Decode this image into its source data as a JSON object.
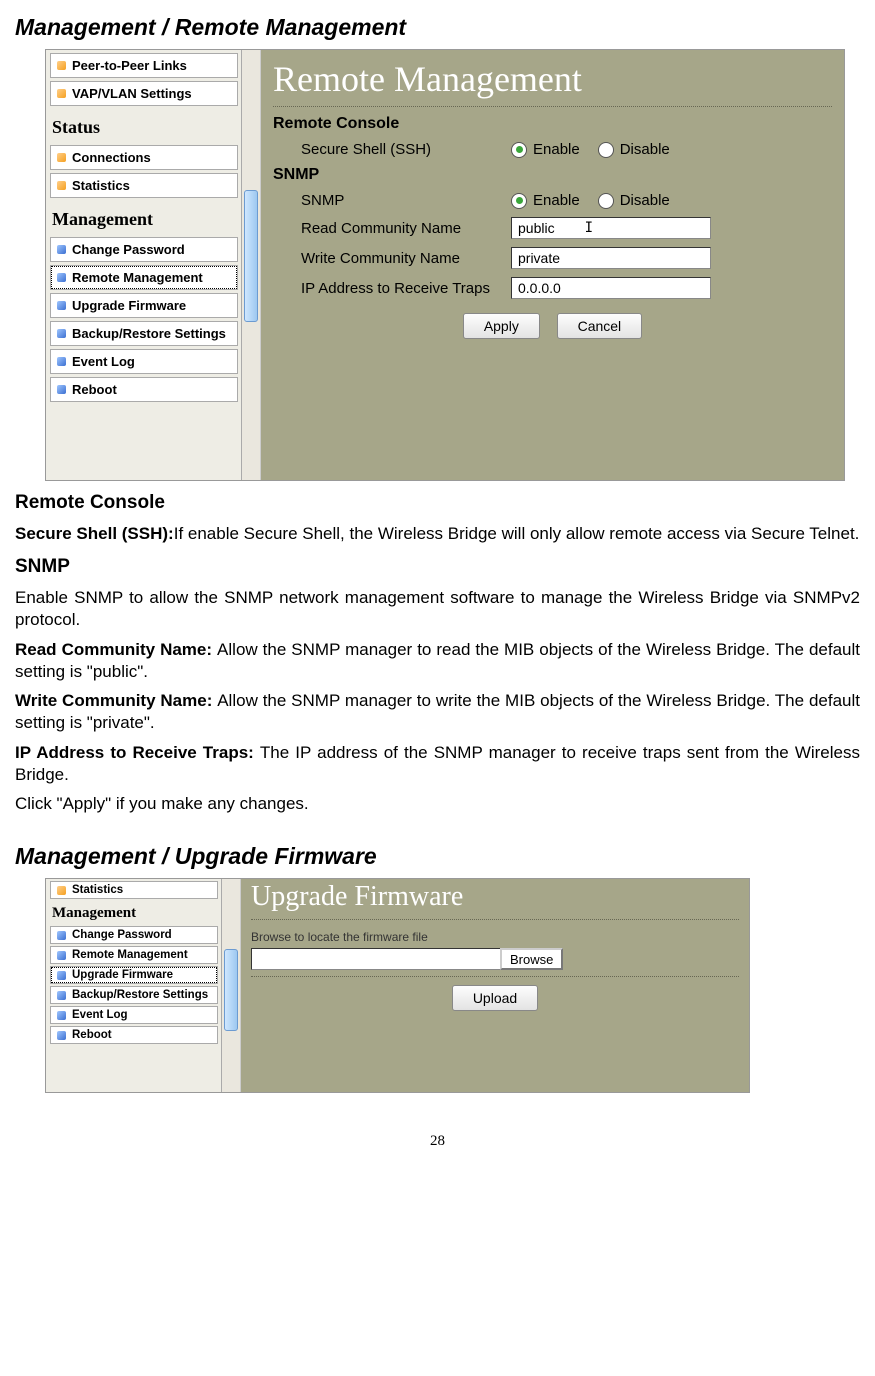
{
  "heading1": "Management / Remote Management",
  "screenshot1": {
    "sidebar": {
      "items_top": [
        {
          "label": "Peer-to-Peer Links",
          "bullet": "orange"
        },
        {
          "label": "VAP/VLAN Settings",
          "bullet": "orange"
        }
      ],
      "status_heading": "Status",
      "status_items": [
        {
          "label": "Connections",
          "bullet": "orange"
        },
        {
          "label": "Statistics",
          "bullet": "orange"
        }
      ],
      "mgmt_heading": "Management",
      "mgmt_items": [
        {
          "label": "Change Password",
          "bullet": "blue"
        },
        {
          "label": "Remote Management",
          "bullet": "blue",
          "selected": true
        },
        {
          "label": "Upgrade Firmware",
          "bullet": "blue"
        },
        {
          "label": "Backup/Restore Settings",
          "bullet": "blue"
        },
        {
          "label": "Event Log",
          "bullet": "blue"
        },
        {
          "label": "Reboot",
          "bullet": "blue"
        }
      ]
    },
    "main": {
      "title": "Remote Management",
      "remote_console_heading": "Remote Console",
      "ssh_label": "Secure Shell (SSH)",
      "enable": "Enable",
      "disable": "Disable",
      "snmp_heading": "SNMP",
      "snmp_label": "SNMP",
      "read_label": "Read Community Name",
      "read_value": "public",
      "write_label": "Write Community Name",
      "write_value": "private",
      "ip_label": "IP Address to Receive Traps",
      "ip_value": "0.0.0.0",
      "apply": "Apply",
      "cancel": "Cancel"
    }
  },
  "doc": {
    "remote_console": "Remote Console",
    "ssh_label": "Secure Shell (SSH):",
    "ssh_text": "If enable Secure Shell, the Wireless Bridge will only allow remote access via Secure Telnet.",
    "snmp_h": "SNMP",
    "snmp_text": "Enable SNMP to allow the SNMP network management software to manage the Wireless Bridge via SNMPv2 protocol.",
    "read_label": "Read Community Name: ",
    "read_text": "Allow the SNMP manager to read the MIB objects of the Wireless Bridge. The default setting is \"public\".",
    "write_label": "Write Community Name: ",
    "write_text": "Allow the SNMP manager to write the MIB objects of the Wireless Bridge. The default setting is \"private\".",
    "ip_label": "IP Address to Receive Traps: ",
    "ip_text": "The IP address of the SNMP manager to receive traps sent from the Wireless Bridge.",
    "apply_text": "Click \"Apply\" if you make any changes."
  },
  "heading2": "Management / Upgrade Firmware",
  "screenshot2": {
    "sidebar": {
      "top_item": {
        "label": "Statistics",
        "bullet": "orange"
      },
      "mgmt_heading": "Management",
      "mgmt_items": [
        {
          "label": "Change Password",
          "bullet": "blue"
        },
        {
          "label": "Remote Management",
          "bullet": "blue"
        },
        {
          "label": "Upgrade Firmware",
          "bullet": "blue",
          "selected": true
        },
        {
          "label": "Backup/Restore Settings",
          "bullet": "blue"
        },
        {
          "label": "Event Log",
          "bullet": "blue"
        },
        {
          "label": "Reboot",
          "bullet": "blue"
        }
      ]
    },
    "main": {
      "title": "Upgrade Firmware",
      "browse_label": "Browse to locate the firmware file",
      "browse_btn": "Browse",
      "upload_btn": "Upload"
    }
  },
  "page_number": "28"
}
